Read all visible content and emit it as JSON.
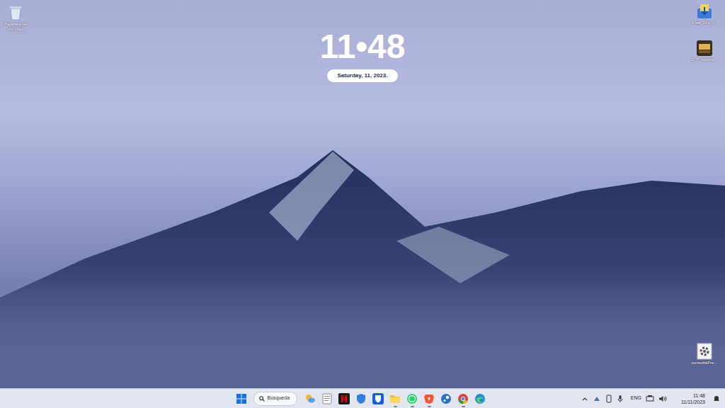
{
  "desktop": {
    "icons": [
      {
        "label": "Papelera de reciclaje",
        "kind": "recycle-bin"
      },
      {
        "label": "Free_Fire_I...",
        "kind": "installer"
      },
      {
        "label": "S_P_installe...",
        "kind": "game"
      },
      {
        "label": "consultaFre...",
        "kind": "settings"
      }
    ]
  },
  "clock": {
    "time": "11•48",
    "date": "Saturday, 11, 2023."
  },
  "taskbar": {
    "search": {
      "placeholder": "Búsqueda"
    },
    "apps": [
      {
        "kind": "widgets",
        "running": false
      },
      {
        "kind": "notepad",
        "running": false
      },
      {
        "kind": "netflix",
        "running": false
      },
      {
        "kind": "shield",
        "running": false
      },
      {
        "kind": "bitwarden",
        "running": false
      },
      {
        "kind": "folder",
        "running": true
      },
      {
        "kind": "whatsapp",
        "running": true
      },
      {
        "kind": "brave",
        "running": true
      },
      {
        "kind": "steam",
        "running": false
      },
      {
        "kind": "chrome",
        "running": true
      },
      {
        "kind": "edge",
        "running": false
      }
    ],
    "tray": {
      "language": "ENG",
      "time": "11:48",
      "date": "11/11/2023"
    }
  }
}
